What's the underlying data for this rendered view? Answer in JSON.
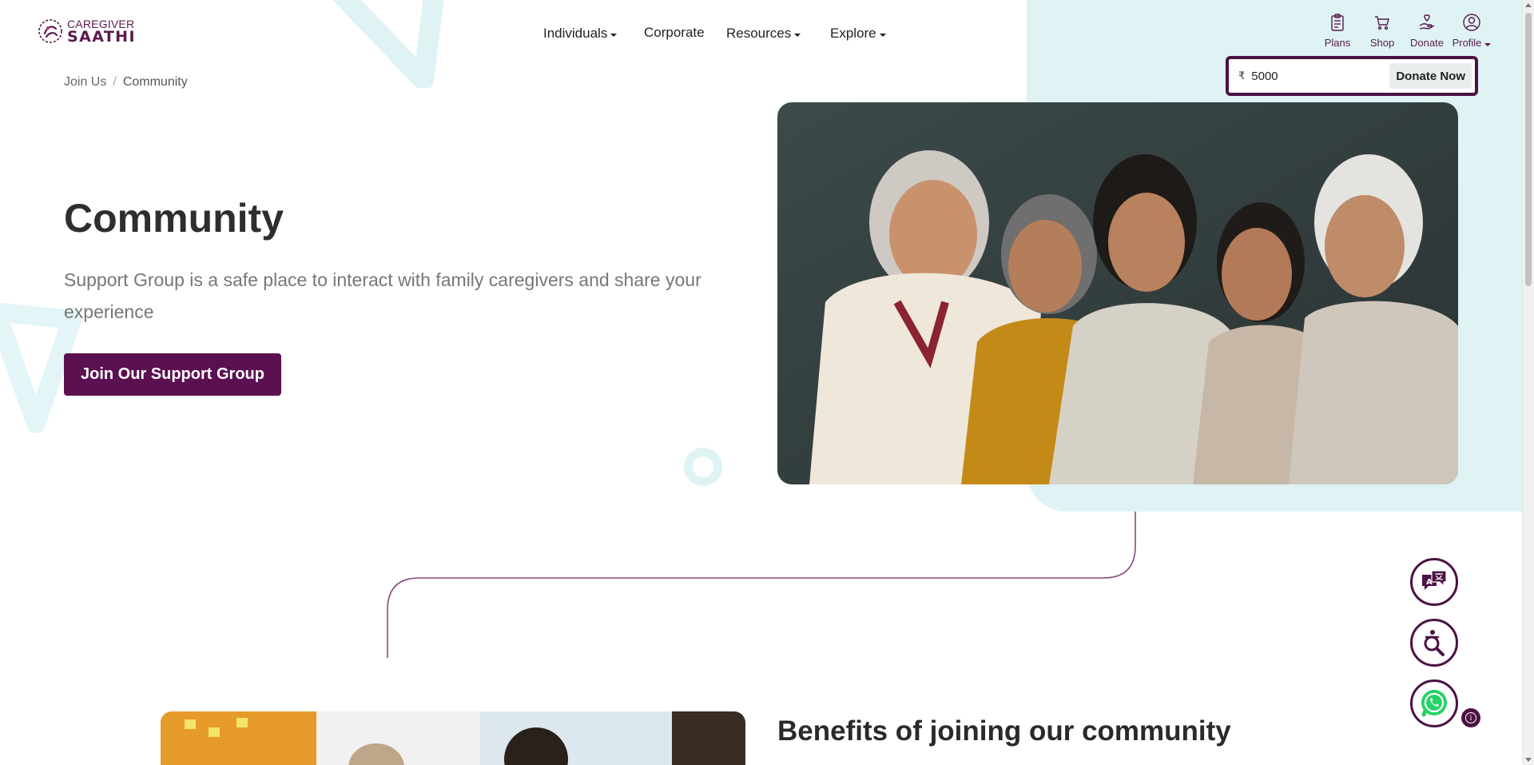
{
  "brand": {
    "logo_top": "CAREGIVER",
    "logo_bottom": "SAATHI",
    "color": "#5a1a4e"
  },
  "nav": {
    "items": [
      {
        "label": "Individuals",
        "dropdown": true
      },
      {
        "label": "Corporate",
        "dropdown": false
      },
      {
        "label": "Resources",
        "dropdown": true
      },
      {
        "label": "Explore",
        "dropdown": true
      }
    ]
  },
  "top_icons": [
    {
      "label": "Plans",
      "icon": "clipboard-icon"
    },
    {
      "label": "Shop",
      "icon": "cart-icon"
    },
    {
      "label": "Donate",
      "icon": "donate-hand-heart-icon"
    },
    {
      "label": "Profile",
      "icon": "user-icon"
    }
  ],
  "donate": {
    "currency_symbol": "₹",
    "amount": "5000",
    "button_label": "Donate Now"
  },
  "breadcrumb": {
    "items": [
      "Join Us",
      "Community"
    ],
    "separator": "/"
  },
  "hero": {
    "title": "Community",
    "subtitle": "Support Group is a safe place to interact with family caregivers and share your experience",
    "cta_label": "Join Our Support Group",
    "photo": "group-of-smiling-women-photo"
  },
  "benefits": {
    "title": "Benefits of joining our community"
  },
  "floating": [
    {
      "name": "translate-icon"
    },
    {
      "name": "accessibility-search-icon"
    },
    {
      "name": "whatsapp-icon"
    }
  ],
  "info_badge": "i",
  "colors": {
    "primary": "#5b1050",
    "accent_bg": "#dff3f5",
    "whatsapp": "#25d366"
  }
}
